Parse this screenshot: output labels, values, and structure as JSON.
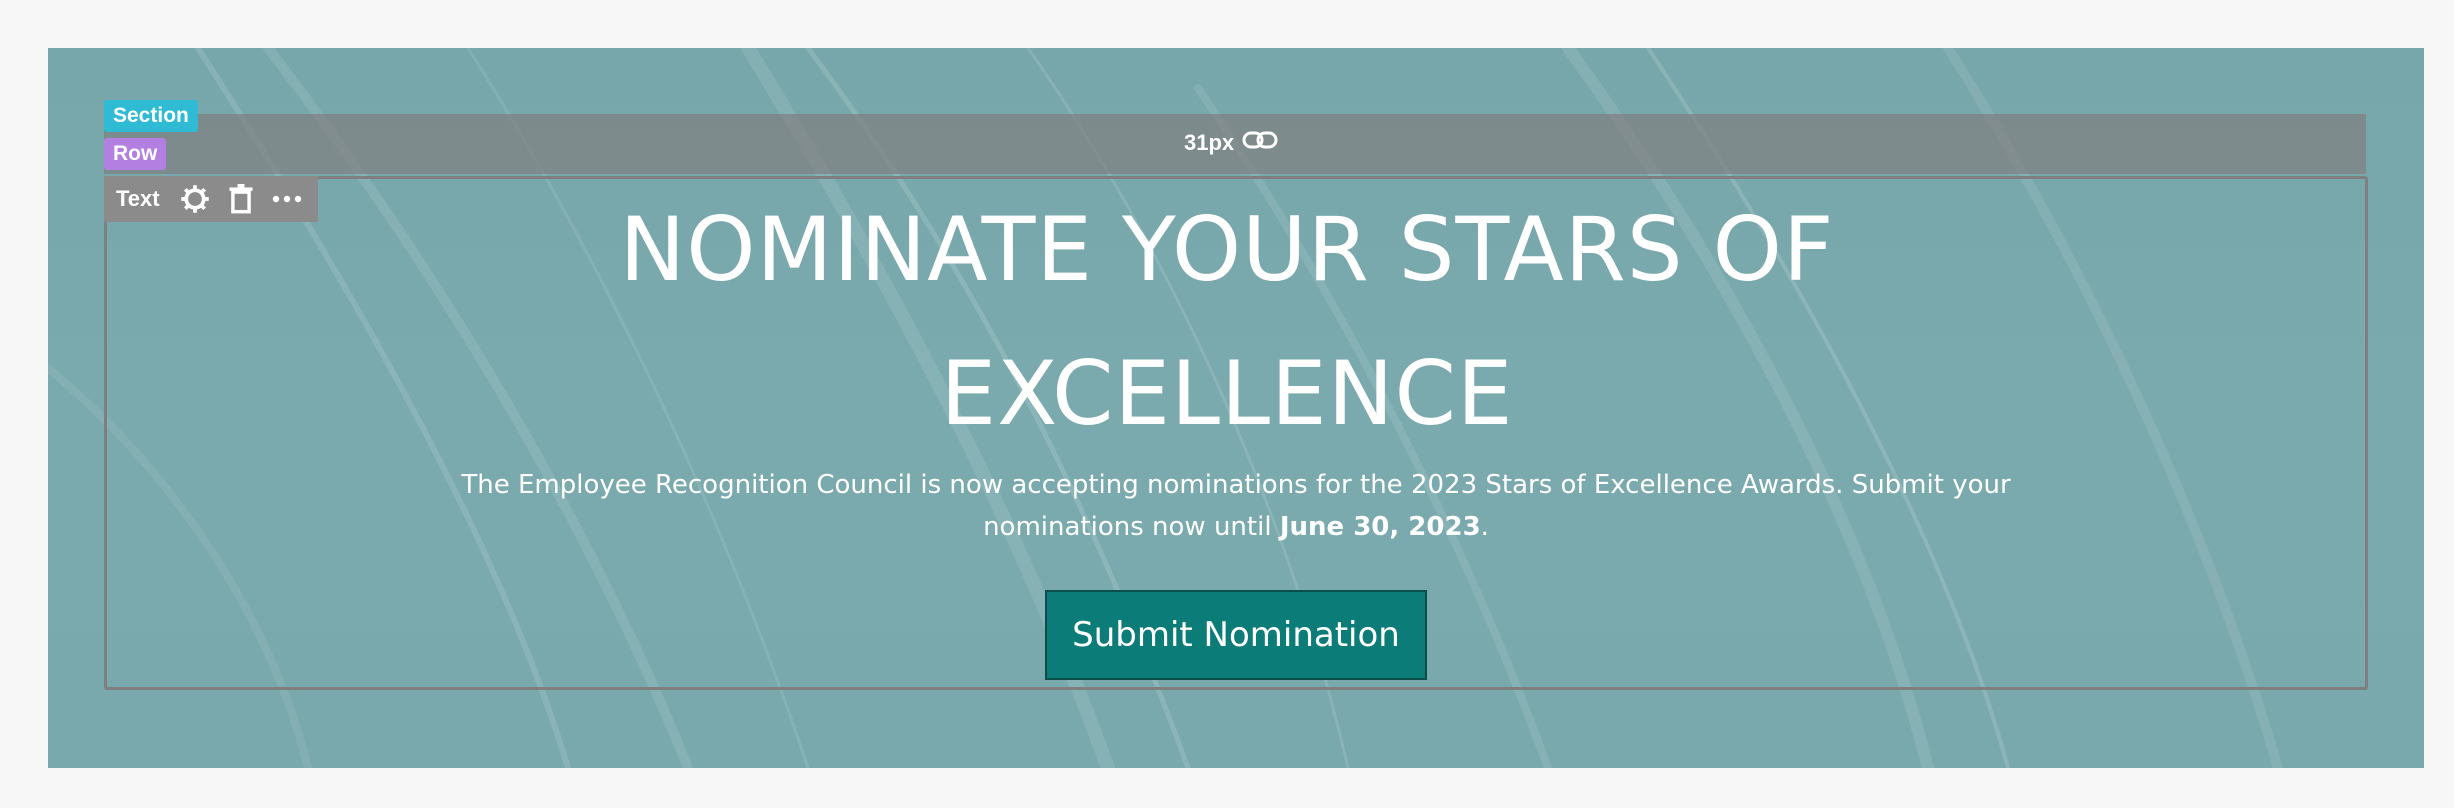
{
  "editor": {
    "section_tag": "Section",
    "row_tag": "Row",
    "spacing_value": "31px",
    "text_toolbar_label": "Text",
    "icons": [
      "link-icon",
      "gear-icon",
      "trash-icon",
      "more-icon"
    ]
  },
  "hero": {
    "headline_line1": "NOMINATE YOUR STARS OF",
    "headline_line2": "EXCELLENCE",
    "description_prefix": "The Employee Recognition Council is now accepting nominations for the 2023 Stars of Excellence Awards. Submit your nominations now until ",
    "description_date": "June 30, 2023",
    "description_suffix": ".",
    "cta_label": "Submit Nomination"
  },
  "colors": {
    "section_bg": "#79a9ad",
    "section_tag": "#2fbbd3",
    "row_tag": "#b37fe0",
    "cta_bg": "#0c7c79"
  }
}
